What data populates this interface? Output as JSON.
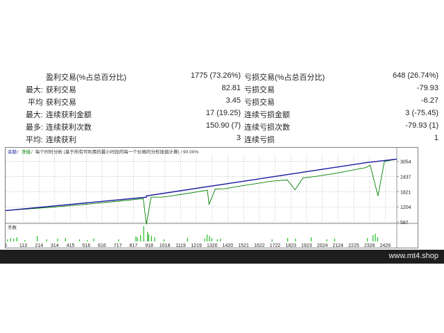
{
  "stats": {
    "rows": [
      {
        "prefix": "",
        "label1": "盈利交易(%占总百分比)",
        "value1": "1775 (73.26%)",
        "label2": "亏损交易(%占总百分比)",
        "value2": "648 (26.74%)"
      },
      {
        "prefix": "最大:",
        "label1": "获利交易",
        "value1": "82.81",
        "label2": "亏损交易",
        "value2": "-79.93"
      },
      {
        "prefix": "平均",
        "label1": "获利交易",
        "value1": "3.45",
        "label2": "亏损交易",
        "value2": "-6.27"
      },
      {
        "prefix": "最大:",
        "label1": "连续获利金额",
        "value1": "17 (19.25)",
        "label2": "连续亏损金额",
        "value2": "3 (-75.45)"
      },
      {
        "prefix": "最多:",
        "label1": "连续获利次数",
        "value1": "150.90 (7)",
        "label2": "连续亏损次数",
        "value2": "-79.93 (1)"
      },
      {
        "prefix": "平均:",
        "label1": "连续获利",
        "value1": "3",
        "label2": "连续亏损",
        "value2": "1"
      }
    ]
  },
  "chart": {
    "legend": {
      "balance": "余额",
      "equity": "净值",
      "desc": "每个时时分析 (基于所有可利用的最小时段的每一个价格的分形插值计算) / 90.00%"
    },
    "volume_label": "手数",
    "colors": {
      "balance": "#1a1aa0",
      "equity": "#008000",
      "volume": "#22bb22",
      "grid": "#9a9a9a"
    }
  },
  "chart_data": {
    "type": "line",
    "series": [
      {
        "name": "余额",
        "x": [
          0,
          900,
          900,
          2300,
          2500
        ],
        "y": [
          1050,
          1600,
          1650,
          3000,
          3150
        ]
      },
      {
        "name": "净值",
        "x": [
          0,
          150,
          300,
          500,
          700,
          880,
          900,
          930,
          1000,
          1100,
          1200,
          1290,
          1300,
          1340,
          1400,
          1500,
          1600,
          1700,
          1800,
          1850,
          1900,
          2000,
          2100,
          2200,
          2300,
          2330,
          2380,
          2420,
          2500
        ],
        "y": [
          1050,
          1120,
          1190,
          1300,
          1420,
          1540,
          -10,
          1600,
          1600,
          1690,
          1790,
          1880,
          1300,
          1930,
          1940,
          2050,
          2150,
          2250,
          2300,
          1900,
          2380,
          2460,
          2560,
          2680,
          2800,
          2900,
          1650,
          3050,
          3150
        ]
      }
    ],
    "y_ticks": [
      "3054",
      "2437",
      "1821",
      "1204",
      "587"
    ],
    "x_ticks": [
      "0",
      "113",
      "214",
      "314",
      "415",
      "516",
      "616",
      "717",
      "817",
      "918",
      "1018",
      "1119",
      "1219",
      "1320",
      "1420",
      "1521",
      "1622",
      "1722",
      "1823",
      "1923",
      "2024",
      "2124",
      "2225",
      "2326",
      "2426"
    ],
    "xlim": [
      0,
      2500
    ],
    "ylim": [
      587,
      3300
    ],
    "volume": {
      "x": [
        10,
        30,
        50,
        70,
        120,
        200,
        260,
        330,
        380,
        470,
        520,
        560,
        720,
        830,
        840,
        860,
        880,
        905,
        912,
        930,
        950,
        1010,
        1160,
        1270,
        1285,
        1300,
        1315,
        1350,
        1370,
        1700,
        1800,
        1850,
        1950,
        2050,
        2100,
        2310,
        2345,
        2360,
        2375
      ],
      "y": [
        3,
        5,
        4,
        6,
        2,
        8,
        3,
        4,
        5,
        3,
        2,
        4,
        3,
        7,
        6,
        9,
        22,
        14,
        10,
        8,
        6,
        3,
        5,
        4,
        10,
        8,
        5,
        3,
        4,
        3,
        5,
        4,
        6,
        3,
        4,
        5,
        9,
        11,
        6
      ]
    }
  },
  "footer": {
    "watermark": "www.mt4.shop"
  }
}
